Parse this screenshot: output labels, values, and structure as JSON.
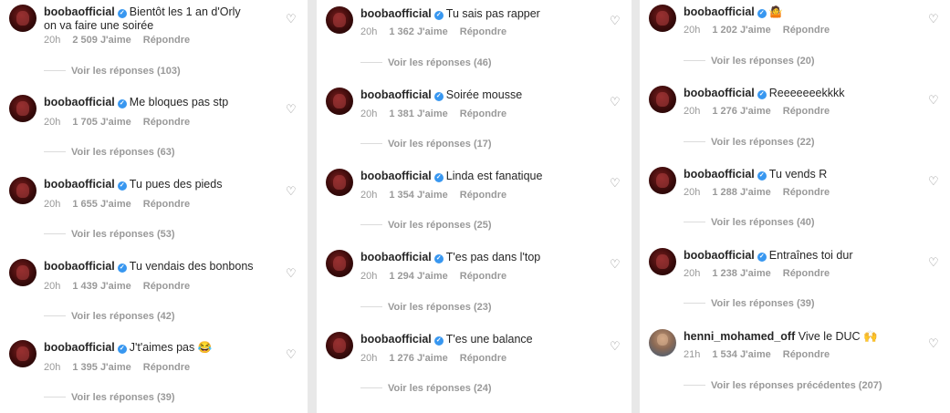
{
  "columns": [
    {
      "comments": [
        {
          "user": "boobaofficial",
          "text": "Bientôt les 1 an d'Orly",
          "text2": "on va faire une soirée",
          "time": "20h",
          "likes": "2 509 J'aime",
          "reply": "Répondre",
          "replies": "Voir les réponses (103)"
        },
        {
          "user": "boobaofficial",
          "text": "Me bloques pas stp",
          "time": "20h",
          "likes": "1 705 J'aime",
          "reply": "Répondre",
          "replies": "Voir les réponses (63)"
        },
        {
          "user": "boobaofficial",
          "text": "Tu pues des pieds",
          "time": "20h",
          "likes": "1 655 J'aime",
          "reply": "Répondre",
          "replies": "Voir les réponses (53)"
        },
        {
          "user": "boobaofficial",
          "text": "Tu vendais des bonbons",
          "time": "20h",
          "likes": "1 439 J'aime",
          "reply": "Répondre",
          "replies": "Voir les réponses (42)"
        },
        {
          "user": "boobaofficial",
          "text": "J't'aimes pas 😂",
          "time": "20h",
          "likes": "1 395 J'aime",
          "reply": "Répondre",
          "replies": "Voir les réponses (39)"
        }
      ]
    },
    {
      "comments": [
        {
          "user": "boobaofficial",
          "text": "Tu sais pas rapper",
          "time": "20h",
          "likes": "1 362 J'aime",
          "reply": "Répondre",
          "replies": "Voir les réponses (46)"
        },
        {
          "user": "boobaofficial",
          "text": "Soirée mousse",
          "time": "20h",
          "likes": "1 381 J'aime",
          "reply": "Répondre",
          "replies": "Voir les réponses (17)"
        },
        {
          "user": "boobaofficial",
          "text": "Linda est fanatique",
          "time": "20h",
          "likes": "1 354 J'aime",
          "reply": "Répondre",
          "replies": "Voir les réponses (25)"
        },
        {
          "user": "boobaofficial",
          "text": "T'es pas dans l'top",
          "time": "20h",
          "likes": "1 294 J'aime",
          "reply": "Répondre",
          "replies": "Voir les réponses (23)"
        },
        {
          "user": "boobaofficial",
          "text": "T'es une balance",
          "time": "20h",
          "likes": "1 276 J'aime",
          "reply": "Répondre",
          "replies": "Voir les réponses (24)"
        }
      ]
    },
    {
      "comments": [
        {
          "user": "boobaofficial",
          "text": "🤷",
          "time": "20h",
          "likes": "1 202 J'aime",
          "reply": "Répondre",
          "replies": "Voir les réponses (20)"
        },
        {
          "user": "boobaofficial",
          "text": "Reeeeeeekkkk",
          "time": "20h",
          "likes": "1 276 J'aime",
          "reply": "Répondre",
          "replies": "Voir les réponses (22)"
        },
        {
          "user": "boobaofficial",
          "text": "Tu vends R",
          "time": "20h",
          "likes": "1 288 J'aime",
          "reply": "Répondre",
          "replies": "Voir les réponses (40)"
        },
        {
          "user": "boobaofficial",
          "text": "Entraînes toi dur",
          "time": "20h",
          "likes": "1 238 J'aime",
          "reply": "Répondre",
          "replies": "Voir les réponses (39)"
        },
        {
          "user": "henni_mohamed_off",
          "text": "Vive le DUC 🙌",
          "time": "21h",
          "likes": "1 534 J'aime",
          "reply": "Répondre",
          "replies": "Voir les réponses précédentes (207)"
        }
      ]
    }
  ],
  "icons": {
    "heart": "heart-icon",
    "verified": "verified-badge-icon"
  }
}
